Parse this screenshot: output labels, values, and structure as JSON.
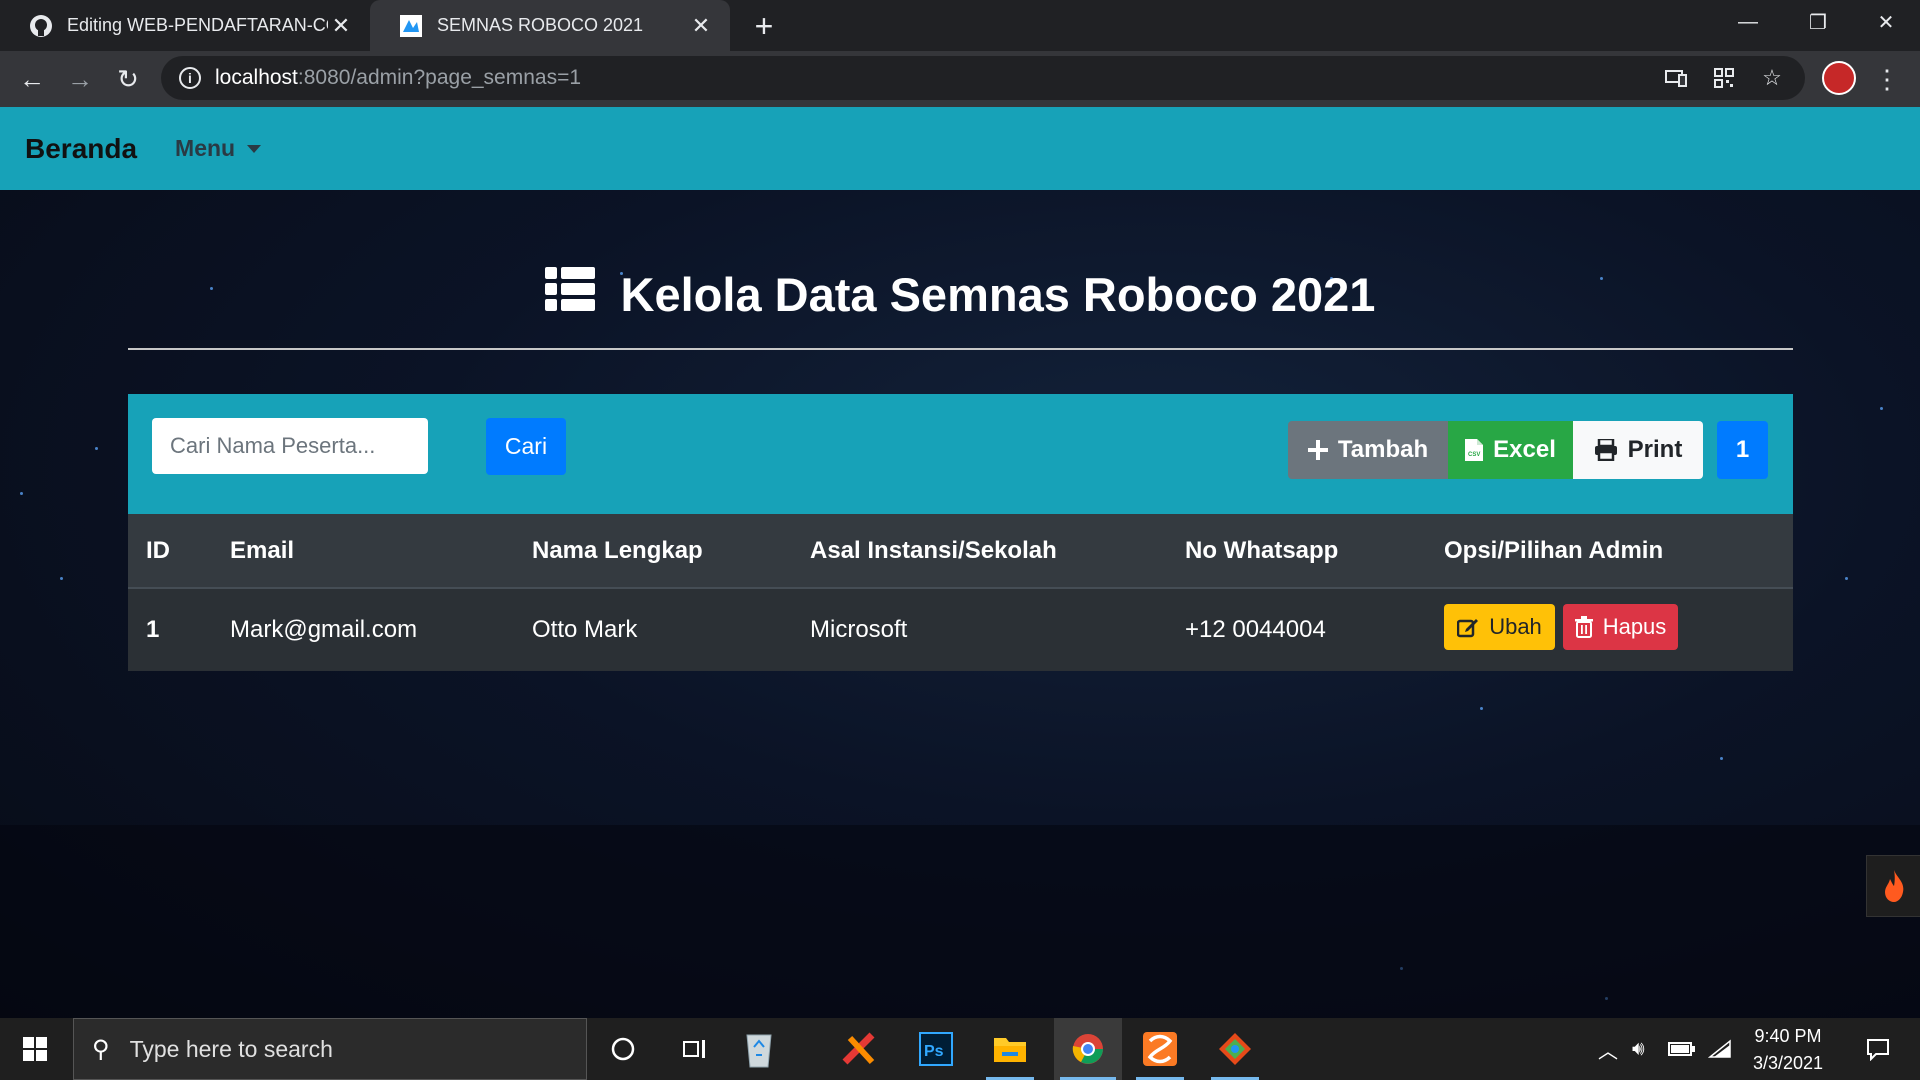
{
  "browser": {
    "tabs": [
      {
        "title": "Editing WEB-PENDAFTARAN-CO",
        "active": false,
        "icon": "github-icon"
      },
      {
        "title": "SEMNAS ROBOCO 2021",
        "active": true,
        "icon": "roboco-favicon"
      }
    ],
    "url_host": "localhost",
    "url_rest": ":8080/admin?page_semnas=1"
  },
  "navbar": {
    "brand": "Beranda",
    "menu_label": "Menu"
  },
  "page": {
    "heading": "Kelola Data Semnas Roboco 2021",
    "search_placeholder": "Cari Nama Peserta...",
    "search_button": "Cari",
    "actions": {
      "tambah": "Tambah",
      "excel": "Excel",
      "print": "Print"
    },
    "pagination_current": "1"
  },
  "table": {
    "columns": [
      "ID",
      "Email",
      "Nama Lengkap",
      "Asal Instansi/Sekolah",
      "No Whatsapp",
      "Opsi/Pilihan Admin"
    ],
    "rows": [
      {
        "id": "1",
        "email": "Mark@gmail.com",
        "nama": "Otto Mark",
        "instansi": "Microsoft",
        "whatsapp": "+12 0044004",
        "edit": "Ubah",
        "delete": "Hapus"
      }
    ]
  },
  "taskbar": {
    "search_placeholder": "Type here to search",
    "time": "9:40 PM",
    "date": "3/3/2021"
  },
  "colors": {
    "accent": "#17a2b8",
    "primary": "#007bff",
    "success": "#28a745",
    "warning": "#ffc107",
    "danger": "#dc3545"
  }
}
